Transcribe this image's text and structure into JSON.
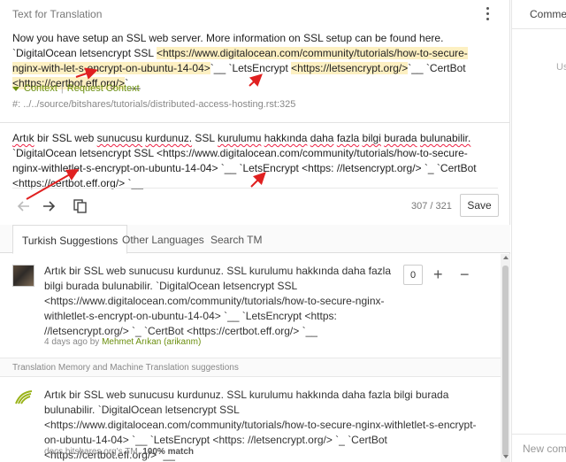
{
  "source": {
    "header": "Text for Translation",
    "text_parts": [
      "Now you have setup an SSL web server. More information on SSL setup can be found here. `DigitalOcean letsencrypt SSL ",
      "<https://www.digitalocean.com/community/tutorials/how-to-secure-nginx-with-let-s-encrypt-on-ubuntu-14-04>",
      "`__ `LetsEncrypt ",
      "<https://letsencrypt.org/>",
      "`__ `CertBot ",
      "<https://certbot.eff.org/>",
      "`__"
    ],
    "context_label": "Context",
    "request_context_label": "Request Context",
    "file_reference": "#: ../../source/bitshares/tutorials/distributed-access-hosting.rst:325"
  },
  "translation": {
    "words": [
      "Artık",
      "bir",
      "SSL",
      "web",
      "sunucusu",
      "kurdunuz.",
      "SSL",
      "kurulumu",
      "hakkında",
      "daha",
      "fazla",
      "bilgi",
      "burada",
      "bulunabilir."
    ],
    "rest": " `DigitalOcean letsencrypt SSL <https://www.digitalocean.com/community/tutorials/how-to-secure-nginx-withletlet-s-encrypt-on-ubuntu-14-04> `__ `LetsEncrypt <https: //letsencrypt.org/> `_ `CertBot <https://certbot.eff.org/> `__",
    "counter": "307 / 321",
    "save_label": "Save"
  },
  "tabs": [
    {
      "label": "Turkish Suggestions",
      "active": true
    },
    {
      "label": "Other Languages",
      "active": false
    },
    {
      "label": "Search TM",
      "active": false
    }
  ],
  "suggestion_1": {
    "text": "Artık bir SSL web sunucusu kurdunuz. SSL kurulumu hakkında daha fazla bilgi burada bulunabilir. `DigitalOcean letsencrypt SSL <https://www.digitalocean.com/community/tutorials/how-to-secure-nginx-withletlet-s-encrypt-on-ubuntu-14-04> `__ `LetsEncrypt <https: //letsencrypt.org/> `_ `CertBot <https://certbot.eff.org/> `__",
    "time": "4 days ago",
    "by": "by",
    "user": "Mehmet Arıkan (arikanm)",
    "votes": "0",
    "plus": "+",
    "minus": "−"
  },
  "tm_heading": "Translation Memory and Machine Translation suggestions",
  "suggestion_2": {
    "text": "Artık bir SSL web sunucusu kurdunuz. SSL kurulumu hakkında daha fazla bilgi burada bulunabilir. `DigitalOcean letsencrypt SSL <https://www.digitalocean.com/community/tutorials/how-to-secure-nginx-withletlet-s-encrypt-on-ubuntu-14-04> `__ `LetsEncrypt <https: //letsencrypt.org/> `_ `CertBot <https://certbot.eff.org/> `__",
    "source": "docs.bitshares.org's TM,",
    "match": "100% match"
  },
  "sidebar": {
    "tab_label": "Comments",
    "faint_text": "Us",
    "bottom_label": "New comment"
  },
  "colors": {
    "accent": "#6b8f0f",
    "highlight": "#fdf0c2",
    "annotation_arrow": "#e02020",
    "spellcheck": "#e24444"
  },
  "icons": [
    "kebab-menu-icon",
    "arrow-left-icon",
    "arrow-right-icon",
    "copy-source-icon",
    "tm-leaf-icon",
    "user-avatar"
  ]
}
